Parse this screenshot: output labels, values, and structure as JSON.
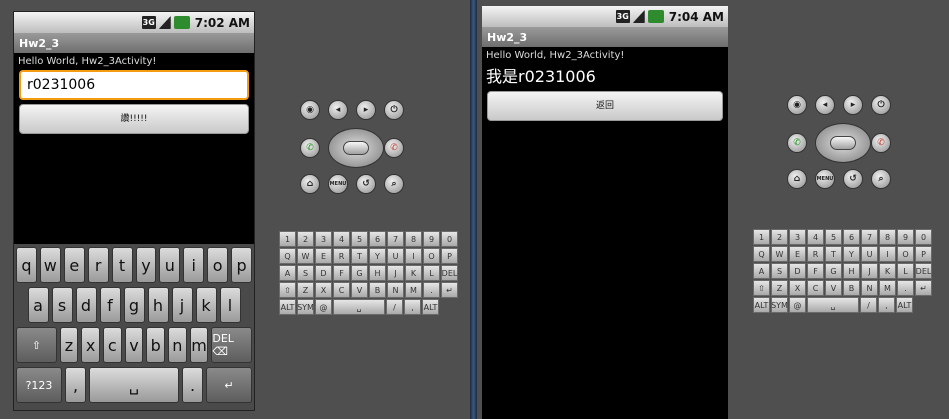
{
  "left": {
    "status": {
      "network": "3G",
      "time": "7:02 AM"
    },
    "title": "Hw2_3",
    "hello": "Hello World, Hw2_3Activity!",
    "input_value": "r0231006",
    "button_label": "讚!!!!!",
    "soft_keyboard": {
      "row1": [
        "q",
        "w",
        "e",
        "r",
        "t",
        "y",
        "u",
        "i",
        "o",
        "p"
      ],
      "row2": [
        "a",
        "s",
        "d",
        "f",
        "g",
        "h",
        "j",
        "k",
        "l"
      ],
      "row3": [
        "⇧",
        "z",
        "x",
        "c",
        "v",
        "b",
        "n",
        "m",
        "DEL ⌫"
      ],
      "row4": [
        "?123",
        ",",
        "␣",
        ".",
        "↵"
      ]
    }
  },
  "right": {
    "status": {
      "network": "3G",
      "time": "7:04 AM"
    },
    "title": "Hw2_3",
    "hello": "Hello World, Hw2_3Activity!",
    "big_text": "我是r0231006",
    "button_label": "返回"
  },
  "controls": {
    "top_row": [
      "camera-icon",
      "volume-down-icon",
      "volume-up-icon",
      "power-icon"
    ],
    "bottom_row": [
      "home-icon",
      "menu-icon",
      "back-icon",
      "search-icon"
    ],
    "menu_label": "MENU"
  },
  "hw_keyboard": {
    "row1": [
      "1",
      "2",
      "3",
      "4",
      "5",
      "6",
      "7",
      "8",
      "9",
      "0"
    ],
    "row2": [
      "Q",
      "W",
      "E",
      "R",
      "T",
      "Y",
      "U",
      "I",
      "O",
      "P"
    ],
    "row3": [
      "A",
      "S",
      "D",
      "F",
      "G",
      "H",
      "J",
      "K",
      "L",
      "DEL"
    ],
    "row4": [
      "⇧",
      "Z",
      "X",
      "C",
      "V",
      "B",
      "N",
      "M",
      ".",
      "↵"
    ],
    "row5": [
      "ALT",
      "SYM",
      "@",
      "␣",
      "/",
      ",",
      "ALT"
    ]
  },
  "colors": {
    "focus": "#f39c12",
    "call": "#1b8f1b",
    "end": "#c0392b",
    "battery": "#2e8b2e"
  }
}
